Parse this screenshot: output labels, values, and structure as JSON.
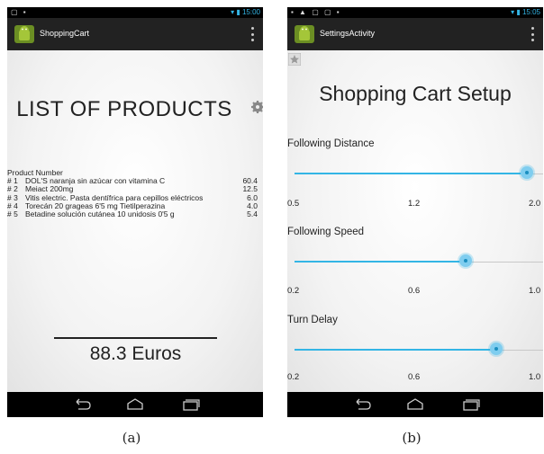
{
  "screen_a": {
    "app_title": "ShoppingCart",
    "list_title": "LIST OF PRODUCTS",
    "products_header": "Product Number",
    "products": [
      {
        "num": "# 1",
        "name": "DOL'S naranja sin azúcar con vitamina C",
        "price": "60.4"
      },
      {
        "num": "# 2",
        "name": "Meiact 200mg",
        "price": "12.5"
      },
      {
        "num": "# 3",
        "name": "Vitis electric. Pasta dentífrica para cepillos eléctricos",
        "price": "6.0"
      },
      {
        "num": "# 4",
        "name": "Torecán 20 grageas 6'5 mg Tietilperazina",
        "price": "4.0"
      },
      {
        "num": "# 5",
        "name": "Betadine solución cutánea 10 unidosis 0'5 g",
        "price": "5.4"
      }
    ],
    "total": "88.3 Euros",
    "status_time": "15:00",
    "caption": "(a)"
  },
  "screen_b": {
    "app_title": "SettingsActivity",
    "setup_title": "Shopping Cart Setup",
    "settings": [
      {
        "label": "Following Distance",
        "min": 0.5,
        "max": 2.0,
        "value": 1.9,
        "ticks": [
          "0.5",
          "1.2",
          "2.0"
        ]
      },
      {
        "label": "Following Speed",
        "min": 0.2,
        "max": 1.0,
        "value": 0.75,
        "ticks": [
          "0.2",
          "0.6",
          "1.0"
        ]
      },
      {
        "label": "Turn Delay",
        "min": 0.2,
        "max": 1.0,
        "value": 0.85,
        "ticks": [
          "0.2",
          "0.6",
          "1.0"
        ]
      }
    ],
    "status_time": "15:05",
    "caption": "(b)"
  },
  "colors": {
    "accent": "#33b5e5",
    "actionbar": "#222222",
    "navbar": "#000000"
  },
  "icons": [
    "android-app-icon",
    "overflow-menu-icon",
    "gear-icon",
    "star-icon",
    "back-icon",
    "home-icon",
    "recent-apps-icon",
    "wifi-icon",
    "battery-icon"
  ]
}
